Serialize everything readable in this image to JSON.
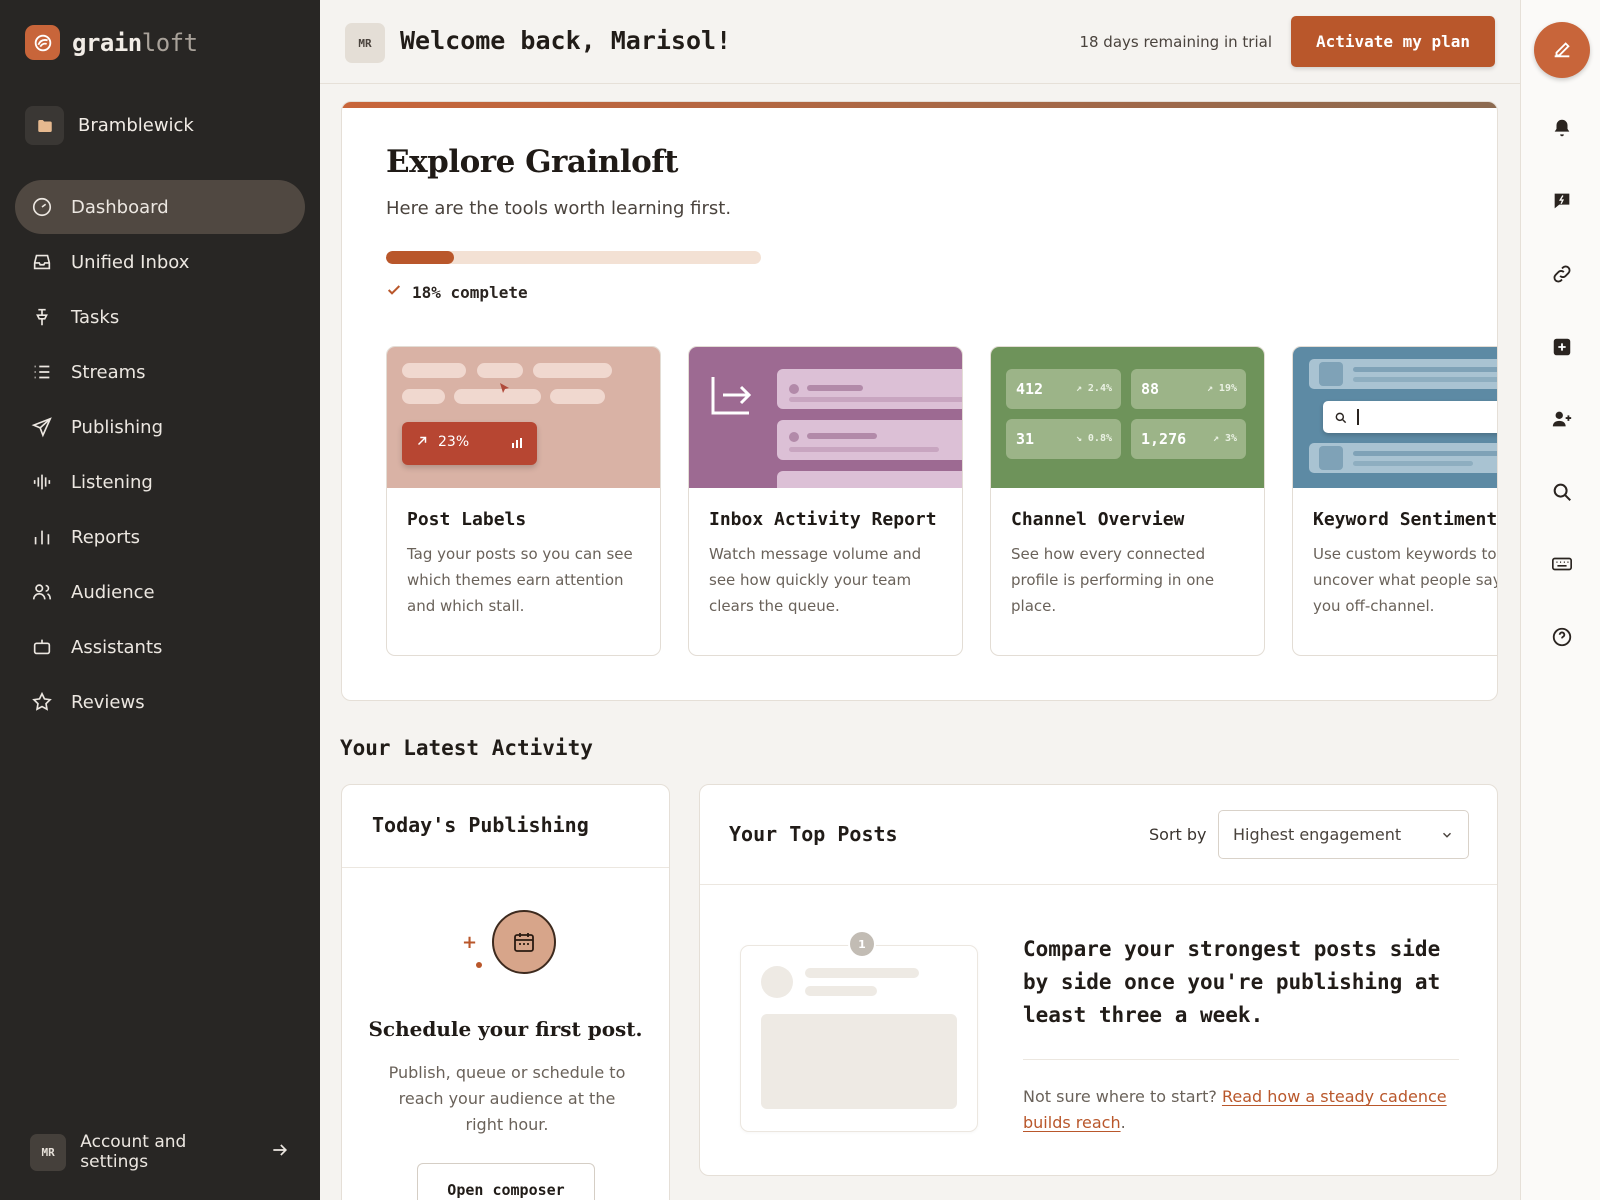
{
  "brand": {
    "name_bold": "grain",
    "name_light": "loft"
  },
  "workspace": {
    "name": "Bramblewick"
  },
  "nav": [
    {
      "label": "Dashboard",
      "icon": "gauge-icon",
      "active": true
    },
    {
      "label": "Unified Inbox",
      "icon": "inbox-icon"
    },
    {
      "label": "Tasks",
      "icon": "pin-icon"
    },
    {
      "label": "Streams",
      "icon": "list-icon"
    },
    {
      "label": "Publishing",
      "icon": "paper-plane-icon"
    },
    {
      "label": "Listening",
      "icon": "soundwave-icon"
    },
    {
      "label": "Reports",
      "icon": "bar-chart-icon"
    },
    {
      "label": "Audience",
      "icon": "users-icon"
    },
    {
      "label": "Assistants",
      "icon": "robot-icon"
    },
    {
      "label": "Reviews",
      "icon": "star-icon"
    }
  ],
  "account": {
    "initials": "MR",
    "label": "Account and settings"
  },
  "header": {
    "initials": "MR",
    "welcome": "Welcome back, Marisol!",
    "trial": "18 days remaining in trial",
    "activate": "Activate my plan"
  },
  "rail": [
    "compose-icon",
    "bell-icon",
    "feedback-icon",
    "link-icon",
    "plus-square-icon",
    "add-user-icon",
    "search-icon",
    "keyboard-icon",
    "help-icon"
  ],
  "explore": {
    "title": "Explore Grainloft",
    "subtitle": "Here are the tools worth learning first.",
    "progress": 18,
    "progress_label": "18% complete",
    "tools": [
      {
        "title": "Post Labels",
        "desc": "Tag your posts so you can see which themes earn attention and which stall.",
        "art": {
          "stat": "23%"
        }
      },
      {
        "title": "Inbox Activity Report",
        "desc": "Watch message volume and see how quickly your team clears the queue."
      },
      {
        "title": "Channel Overview",
        "desc": "See how every connected profile is performing in one place.",
        "art": {
          "tiles": [
            {
              "big": "412",
              "small": "↗ 2.4%"
            },
            {
              "big": "88",
              "small": "↗ 19%"
            },
            {
              "big": "31",
              "small": "↘ 0.8%"
            },
            {
              "big": "1,276",
              "small": "↗ 3%"
            }
          ]
        }
      },
      {
        "title": "Keyword Sentiment",
        "desc": "Use custom keywords to uncover what people say about you off-channel."
      }
    ]
  },
  "activity": {
    "title": "Your Latest Activity",
    "today": {
      "title": "Today's Publishing",
      "heading": "Schedule your first post.",
      "body": "Publish, queue or schedule to reach your audience at the right hour.",
      "button": "Open composer"
    },
    "top_posts": {
      "title": "Your Top Posts",
      "sort_label": "Sort by",
      "sort_value": "Highest engagement",
      "badge": "1",
      "message": "Compare your strongest posts side by side once you're publishing at least three a week.",
      "foot_text": "Not sure where to start? ",
      "foot_link": "Read how a steady cadence builds reach",
      "foot_end": "."
    }
  },
  "colors": {
    "accent": "#b9572b",
    "sidebar": "#282624",
    "sidebar_active": "#504841"
  }
}
